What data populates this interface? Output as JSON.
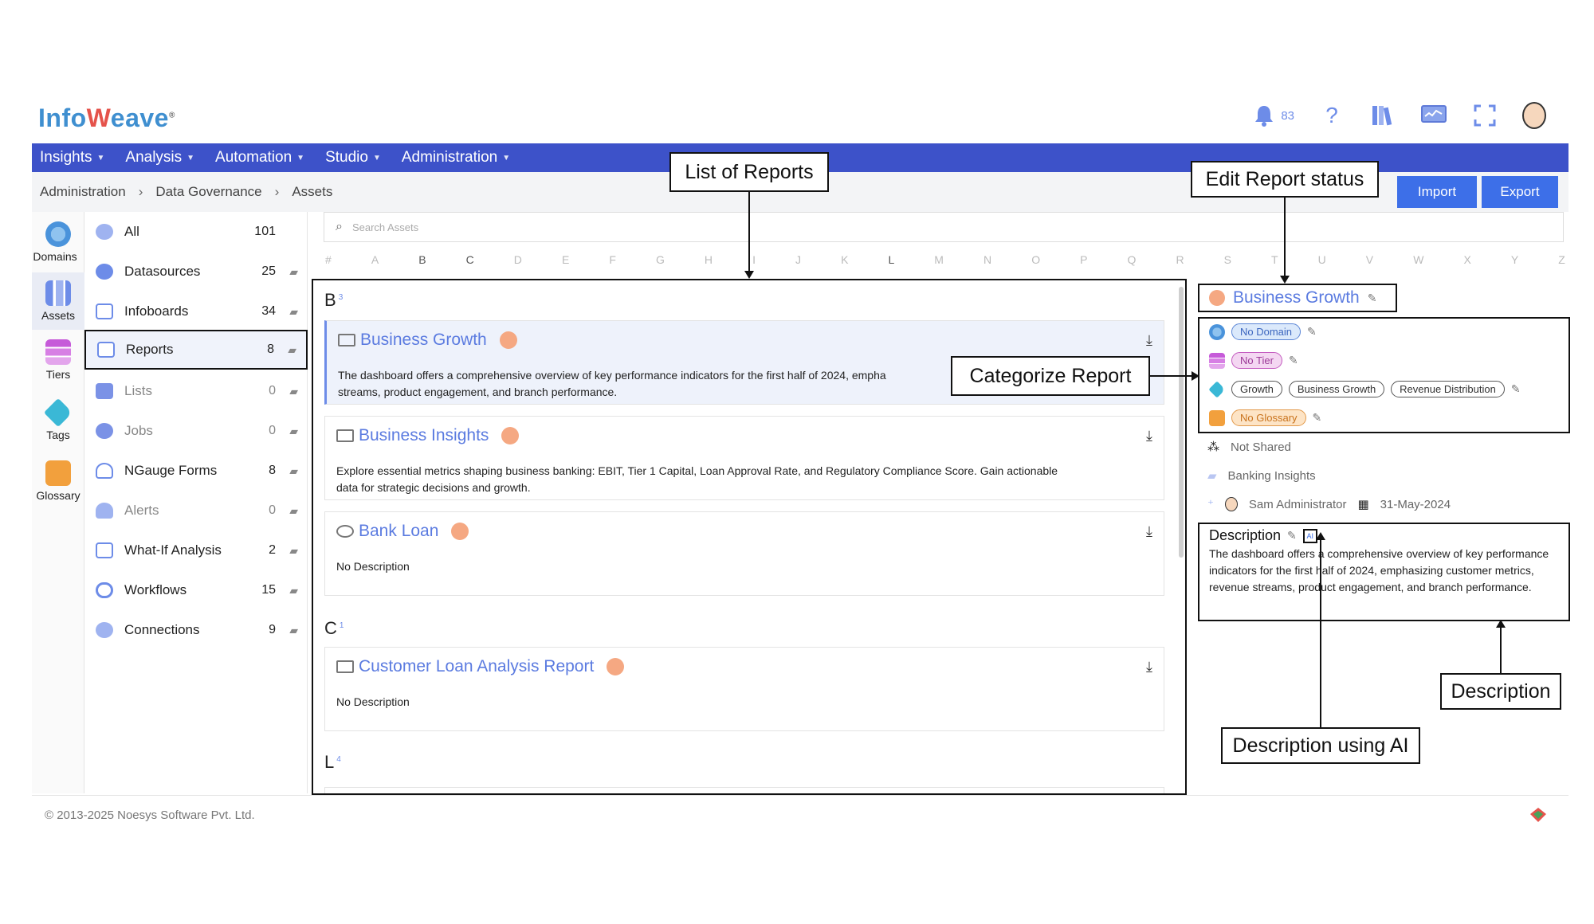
{
  "app": {
    "logo_text_a": "Info",
    "logo_text_b": "eave",
    "logo_mark": "®",
    "notification_count": "83"
  },
  "menu": [
    {
      "label": "Insights"
    },
    {
      "label": "Analysis"
    },
    {
      "label": "Automation"
    },
    {
      "label": "Studio"
    },
    {
      "label": "Administration"
    }
  ],
  "breadcrumb": [
    "Administration",
    "Data Governance",
    "Assets"
  ],
  "actions": {
    "import": "Import",
    "export": "Export"
  },
  "rail": [
    {
      "label": "Domains",
      "icon": "globe-icon"
    },
    {
      "label": "Assets",
      "icon": "assets-icon"
    },
    {
      "label": "Tiers",
      "icon": "layers-icon"
    },
    {
      "label": "Tags",
      "icon": "tag-icon"
    },
    {
      "label": "Glossary",
      "icon": "book-icon"
    }
  ],
  "categories": [
    {
      "label": "All",
      "count": "101",
      "icon": "database-icon"
    },
    {
      "label": "Datasources",
      "count": "25",
      "icon": "datasource-icon"
    },
    {
      "label": "Infoboards",
      "count": "34",
      "icon": "infoboard-icon"
    },
    {
      "label": "Reports",
      "count": "8",
      "icon": "report-icon"
    },
    {
      "label": "Lists",
      "count": "0",
      "icon": "list-icon"
    },
    {
      "label": "Jobs",
      "count": "0",
      "icon": "gears-icon"
    },
    {
      "label": "NGauge Forms",
      "count": "8",
      "icon": "gauge-icon"
    },
    {
      "label": "Alerts",
      "count": "0",
      "icon": "bell-icon"
    },
    {
      "label": "What-If Analysis",
      "count": "2",
      "icon": "calculator-icon"
    },
    {
      "label": "Workflows",
      "count": "15",
      "icon": "workflow-icon"
    },
    {
      "label": "Connections",
      "count": "9",
      "icon": "connection-icon"
    }
  ],
  "search": {
    "placeholder": "Search Assets"
  },
  "alphabet": [
    "#",
    "A",
    "B",
    "C",
    "D",
    "E",
    "F",
    "G",
    "H",
    "I",
    "J",
    "K",
    "L",
    "M",
    "N",
    "O",
    "P",
    "Q",
    "R",
    "S",
    "T",
    "U",
    "V",
    "W",
    "X",
    "Y",
    "Z"
  ],
  "sections": [
    {
      "letter": "B",
      "count": "3"
    },
    {
      "letter": "C",
      "count": "1"
    },
    {
      "letter": "L",
      "count": "4"
    }
  ],
  "reports": [
    {
      "title": "Business Growth",
      "desc": "The dashboard offers a comprehensive overview of key performance indicators for the first half of 2024, empha",
      "desc2": "streams, product engagement, and branch performance."
    },
    {
      "title": "Business Insights",
      "desc": "Explore essential metrics shaping business banking: EBIT, Tier 1 Capital, Loan Approval Rate, and Regulatory Compliance Score. Gain actionable",
      "desc2": "data for strategic decisions and growth."
    },
    {
      "title": "Bank Loan",
      "desc": "No Description",
      "desc2": ""
    },
    {
      "title": "Customer Loan Analysis Report",
      "desc": "No Description",
      "desc2": ""
    }
  ],
  "detail": {
    "title": "Business Growth",
    "domain": "No Domain",
    "tier": "No Tier",
    "tags": [
      "Growth",
      "Business Growth",
      "Revenue Distribution"
    ],
    "glossary": "No Glossary",
    "shared": "Not Shared",
    "folder": "Banking Insights",
    "owner": "Sam Administrator",
    "date": "31-May-2024",
    "description_label": "Description",
    "ai_label": "AI",
    "description": "The dashboard offers a comprehensive overview of key performance indicators for the first half of 2024, emphasizing customer metrics, revenue streams, product engagement, and branch performance."
  },
  "annotations": {
    "list": "List of Reports",
    "status": "Edit Report status",
    "categorize": "Categorize Report",
    "description": "Description",
    "ai": "Description using AI"
  },
  "footer": "© 2013-2025 Noesys Software Pvt. Ltd.",
  "colors": {
    "menubar": "#3d52c9",
    "accent": "#5b7be0",
    "button": "#3d6fe8",
    "status_dot": "#f5a882"
  }
}
